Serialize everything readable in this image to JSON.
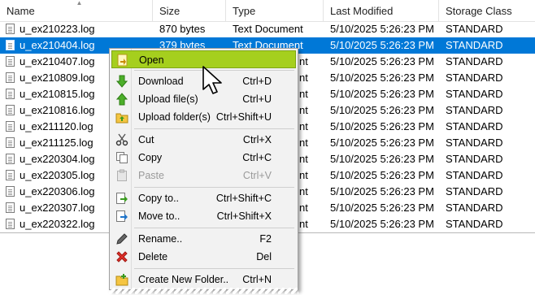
{
  "columns": [
    "Name",
    "Size",
    "Type",
    "Last Modified",
    "Storage Class"
  ],
  "rows": [
    {
      "name": "u_ex210223.log",
      "size": "870 bytes",
      "type": "Text Document",
      "modified": "5/10/2025 5:26:23 PM",
      "storage": "STANDARD"
    },
    {
      "name": "u_ex210404.log",
      "size": "379 bytes",
      "type": "Text Document",
      "modified": "5/10/2025 5:26:23 PM",
      "storage": "STANDARD",
      "selected": true
    },
    {
      "name": "u_ex210407.log",
      "size": "",
      "type": "nt",
      "modified": "5/10/2025 5:26:23 PM",
      "storage": "STANDARD"
    },
    {
      "name": "u_ex210809.log",
      "size": "",
      "type": "nt",
      "modified": "5/10/2025 5:26:23 PM",
      "storage": "STANDARD"
    },
    {
      "name": "u_ex210815.log",
      "size": "",
      "type": "nt",
      "modified": "5/10/2025 5:26:23 PM",
      "storage": "STANDARD"
    },
    {
      "name": "u_ex210816.log",
      "size": "",
      "type": "nt",
      "modified": "5/10/2025 5:26:23 PM",
      "storage": "STANDARD"
    },
    {
      "name": "u_ex211120.log",
      "size": "",
      "type": "nt",
      "modified": "5/10/2025 5:26:23 PM",
      "storage": "STANDARD"
    },
    {
      "name": "u_ex211125.log",
      "size": "",
      "type": "nt",
      "modified": "5/10/2025 5:26:23 PM",
      "storage": "STANDARD"
    },
    {
      "name": "u_ex220304.log",
      "size": "",
      "type": "nt",
      "modified": "5/10/2025 5:26:23 PM",
      "storage": "STANDARD"
    },
    {
      "name": "u_ex220305.log",
      "size": "",
      "type": "nt",
      "modified": "5/10/2025 5:26:23 PM",
      "storage": "STANDARD"
    },
    {
      "name": "u_ex220306.log",
      "size": "",
      "type": "nt",
      "modified": "5/10/2025 5:26:23 PM",
      "storage": "STANDARD"
    },
    {
      "name": "u_ex220307.log",
      "size": "",
      "type": "nt",
      "modified": "5/10/2025 5:26:23 PM",
      "storage": "STANDARD"
    },
    {
      "name": "u_ex220322.log",
      "size": "",
      "type": "nt",
      "modified": "5/10/2025 5:26:23 PM",
      "storage": "STANDARD"
    }
  ],
  "menu": {
    "open": {
      "label": "Open",
      "shortcut": "",
      "icon": "open-icon"
    },
    "download": {
      "label": "Download",
      "shortcut": "Ctrl+D",
      "icon": "download-icon"
    },
    "upload_files": {
      "label": "Upload file(s)",
      "shortcut": "Ctrl+U",
      "icon": "upload-icon"
    },
    "upload_folders": {
      "label": "Upload folder(s)",
      "shortcut": "Ctrl+Shift+U",
      "icon": "upload-folder-icon"
    },
    "cut": {
      "label": "Cut",
      "shortcut": "Ctrl+X",
      "icon": "scissors-icon"
    },
    "copy": {
      "label": "Copy",
      "shortcut": "Ctrl+C",
      "icon": "copy-icon"
    },
    "paste": {
      "label": "Paste",
      "shortcut": "Ctrl+V",
      "icon": "paste-icon",
      "disabled": true
    },
    "copy_to": {
      "label": "Copy to..",
      "shortcut": "Ctrl+Shift+C",
      "icon": "copy-to-icon"
    },
    "move_to": {
      "label": "Move to..",
      "shortcut": "Ctrl+Shift+X",
      "icon": "move-to-icon"
    },
    "rename": {
      "label": "Rename..",
      "shortcut": "F2",
      "icon": "pencil-icon"
    },
    "delete": {
      "label": "Delete",
      "shortcut": "Del",
      "icon": "delete-x-icon"
    },
    "new_folder": {
      "label": "Create New Folder..",
      "shortcut": "Ctrl+N",
      "icon": "new-folder-icon"
    }
  },
  "colors": {
    "selection": "#0078d7",
    "menu_highlight": "#a5cf1e"
  }
}
